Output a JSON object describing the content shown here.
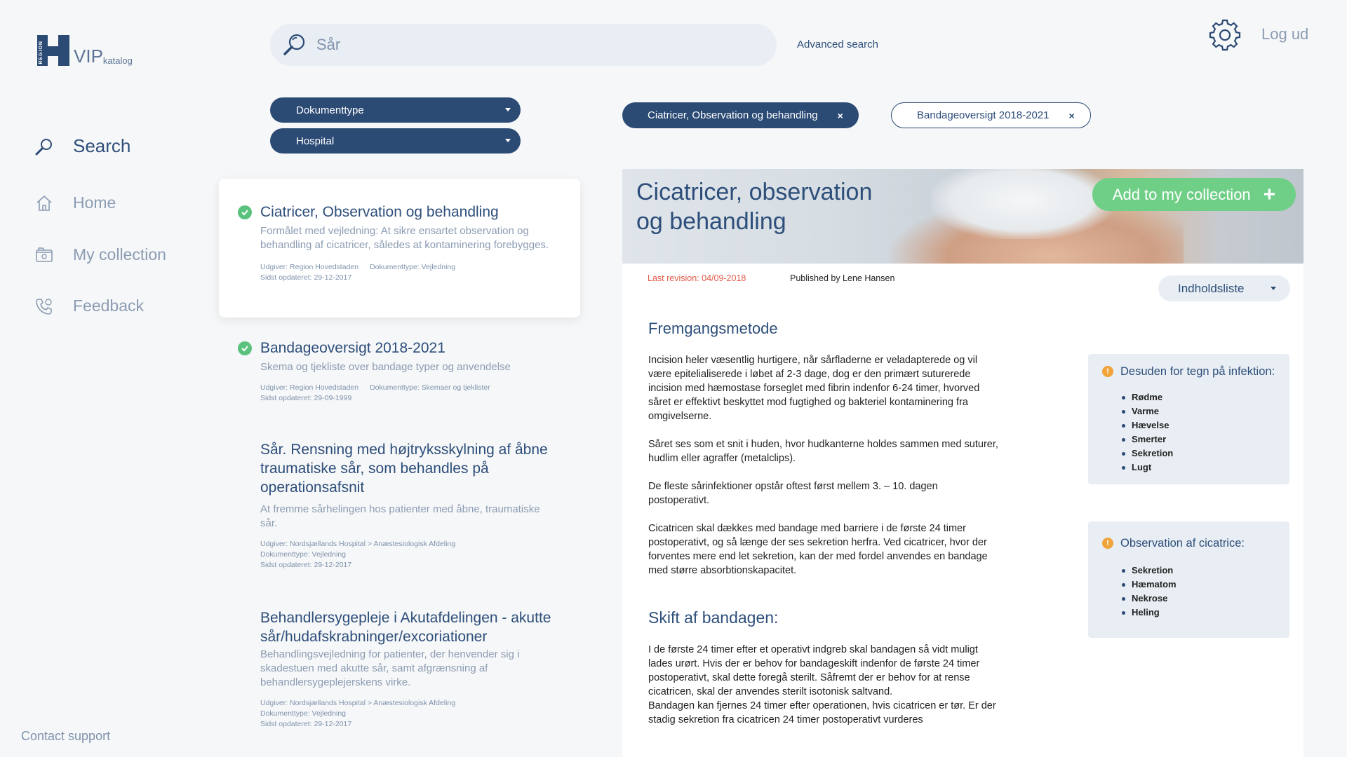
{
  "logo": {
    "text": "VIP",
    "sub": "katalog",
    "mark_text": "REGION"
  },
  "search": {
    "value": "Sår",
    "advanced_label": "Advanced search"
  },
  "header": {
    "logout_label": "Log ud"
  },
  "sidebar": {
    "items": [
      {
        "label": "Search",
        "icon": "search-icon",
        "active": true
      },
      {
        "label": "Home",
        "icon": "home-icon",
        "active": false
      },
      {
        "label": "My collection",
        "icon": "collection-icon",
        "active": false
      },
      {
        "label": "Feedback",
        "icon": "phone-icon",
        "active": false
      }
    ],
    "contact_label": "Contact support"
  },
  "filters": [
    {
      "label": "Dokumenttype"
    },
    {
      "label": "Hospital"
    }
  ],
  "results": [
    {
      "title": "Ciatricer, Observation og behandling",
      "description": "Formålet med vejledning: At sikre ensartet observation og behandling af cicatricer, således at kontaminering forebygges.",
      "meta_line1a": "Udgiver: Region Hovedstaden",
      "meta_line1b": "Dokumenttype: Vejledning",
      "meta_line2": "Sidst opdateret: 29-12-2017",
      "checked": true
    },
    {
      "title": "Bandageoversigt 2018-2021",
      "description": "Skema og tjekliste over bandage typer og anvendelse",
      "meta_line1a": "Udgiver: Region Hovedstaden",
      "meta_line1b": "Dokumenttype: Skemaer og tjeklister",
      "meta_line2": "Sidst opdateret: 29-09-1999",
      "checked": true
    },
    {
      "title": "Sår. Rensning med højtryksskylning af åbne traumatiske sår, som behandles på operationsafsnit",
      "description": "At fremme sårhelingen hos patienter med åbne, traumatiske sår.",
      "meta_line1a": "Udgiver: Nordsjællands Hospital > Anæstesiologisk Afdeling",
      "meta_line1b": "Dokumenttype: Vejledning",
      "meta_line2": "Sidst opdateret: 29-12-2017",
      "checked": false
    },
    {
      "title": "Behandlersygepleje i Akutafdelingen - akutte sår/hudafskrabninger/excoriationer",
      "description": "Behandlingsvejledning for patienter, der henvender sig i skadestuen med akutte sår, samt afgrænsning af behandlersygeplejerskens virke.",
      "meta_line1a": "Udgiver: Nordsjællands Hospital > Anæstesiologisk Afdeling",
      "meta_line1b": "Dokumenttype: Vejledning",
      "meta_line2": "Sidst opdateret: 29-12-2017",
      "checked": false
    }
  ],
  "tags": [
    {
      "label": "Ciatricer, Observation og behandling",
      "close": "×"
    },
    {
      "label": "Bandageoversigt 2018-2021",
      "close": "×"
    }
  ],
  "article": {
    "title": "Cicatricer, observation og behandling",
    "add_label": "Add to my collection",
    "add_plus": "+",
    "revision": "Last revision: 04/09-2018",
    "published": "Published by Lene Hansen",
    "toc_label": "Indholdsliste",
    "section1_title": "Fremgangsmetode",
    "paragraphs": [
      "Incision heler væsentlig hurtigere, når sårfladerne er veladapterede og vil være epitelialiserede i løbet af 2-3 dage, dog er den primært suturerede incision med hæmostase forseglet med fibrin indenfor 6-24 timer, hvorved såret er effektivt beskyttet mod fugtighed og bakteriel kontaminering fra omgivelserne.",
      "Såret ses som et snit i huden, hvor hudkanterne holdes sammen med suturer, hudlim eller agraffer (metalclips).",
      "De fleste sårinfektioner opstår oftest først mellem 3. – 10. dagen postoperativt.",
      "Cicatricen skal dækkes med bandage med barriere i de første 24 timer postoperativt, og så længe der ses sekretion herfra. Ved cicatricer, hvor der forventes mere end let sekretion, kan der med fordel anvendes en bandage med større absorbtionskapacitet."
    ],
    "section2_title": "Skift af bandagen:",
    "paragraph5": "I de første 24 timer efter et operativt indgreb skal bandagen så vidt muligt lades urørt. Hvis der er behov for bandageskift indenfor de første 24 timer postoperativt, skal dette foregå sterilt. Såfremt der er behov for at rense cicatricen, skal der anvendes sterilt isotonisk saltvand.",
    "paragraph6": "Bandagen kan fjernes 24 timer efter operationen, hvis cicatricen er tør. Er der stadig sekretion fra cicatricen 24 timer postoperativt vurderes",
    "infobox1": {
      "title": "Desuden for tegn på infektion:",
      "items": [
        "Rødme",
        "Varme",
        "Hævelse",
        "Smerter",
        "Sekretion",
        "Lugt"
      ]
    },
    "infobox2": {
      "title": "Observation af cicatrice:",
      "items": [
        "Sekretion",
        "Hæmatom",
        "Nekrose",
        "Heling"
      ]
    },
    "warn_glyph": "!"
  },
  "colors": {
    "primary": "#2b4a74",
    "accent_green": "#6fcf87",
    "check_green": "#5ac27d",
    "warning": "#f0a43a",
    "revision_red": "#e05a4a"
  }
}
